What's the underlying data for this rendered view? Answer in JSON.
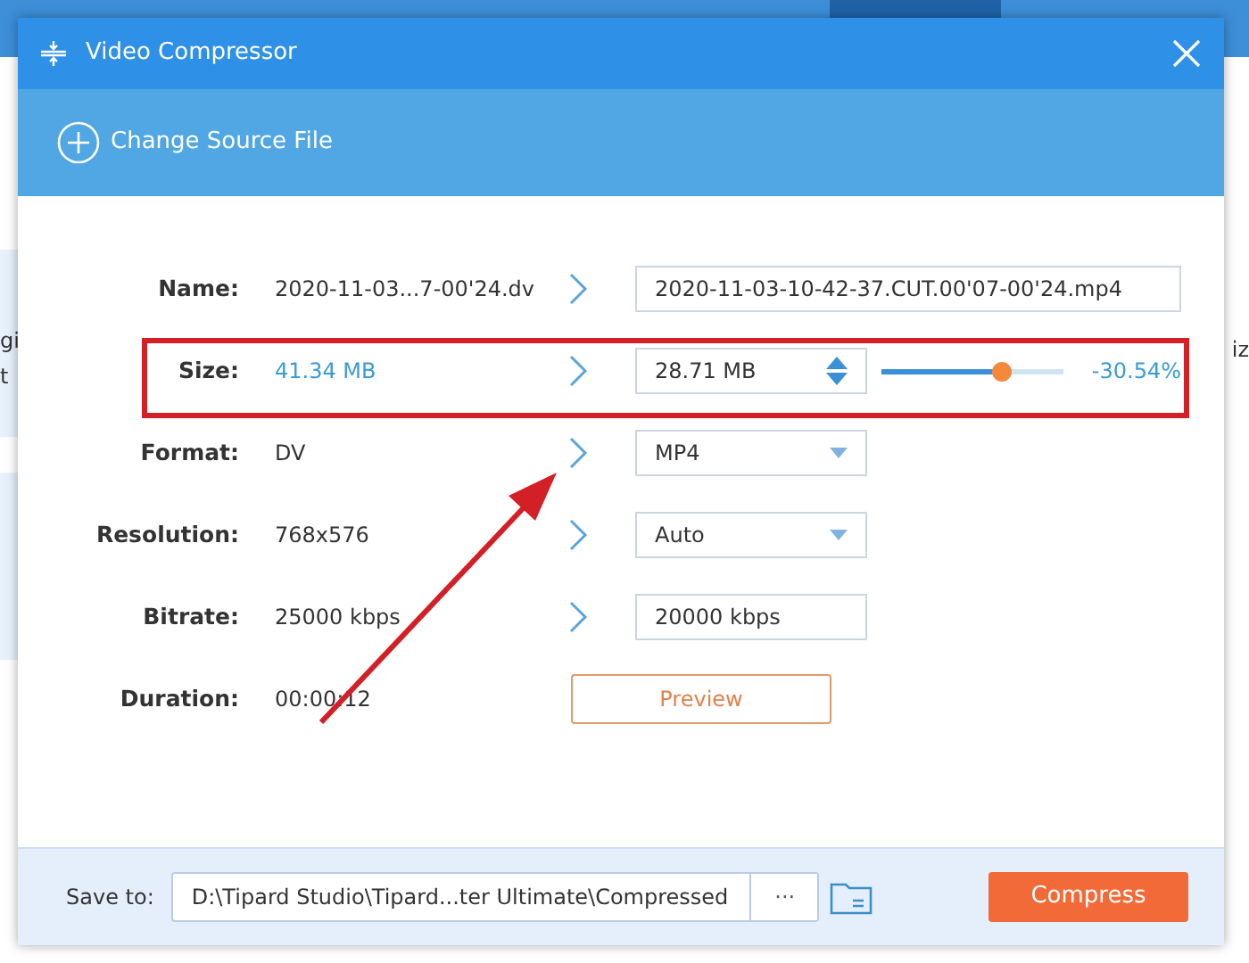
{
  "background": {
    "tabs": [
      {
        "selected": false
      },
      {
        "selected": false
      },
      {
        "selected": false
      },
      {
        "selected": true
      }
    ],
    "left_fragments": [
      {
        "text": "gi"
      },
      {
        "text": "t"
      }
    ],
    "right_fragments": [
      {
        "text": "iz"
      }
    ]
  },
  "dialog": {
    "title": "Video Compressor",
    "change_source": "Change Source File",
    "rows": [
      {
        "kind": "text-field",
        "label": "Name:",
        "source": "2020-11-03...7-00'24.dv",
        "highlight": false,
        "value": "2020-11-03-10-42-37.CUT.00'07-00'24.mp4"
      },
      {
        "kind": "size",
        "label": "Size:",
        "source": "41.34 MB",
        "highlight": true,
        "value": "28.71 MB",
        "level": 0.66,
        "reading": "-30.54%"
      },
      {
        "kind": "select",
        "label": "Format:",
        "source": "DV",
        "highlight": false,
        "value": "MP4"
      },
      {
        "kind": "select",
        "label": "Resolution:",
        "source": "768x576",
        "highlight": false,
        "value": "Auto"
      },
      {
        "kind": "short-field",
        "label": "Bitrate:",
        "source": "25000 kbps",
        "highlight": false,
        "value": "20000 kbps"
      },
      {
        "kind": "button",
        "label": "Duration:",
        "source": "00:00:12",
        "highlight": false,
        "value": "Preview"
      }
    ],
    "footer": {
      "label": "Save to:",
      "path": "D:\\Tipard Studio\\Tipard...ter Ultimate\\Compressed",
      "browse": "···",
      "action": "Compress"
    }
  },
  "annotations": {
    "frame": true,
    "arrow": true
  }
}
